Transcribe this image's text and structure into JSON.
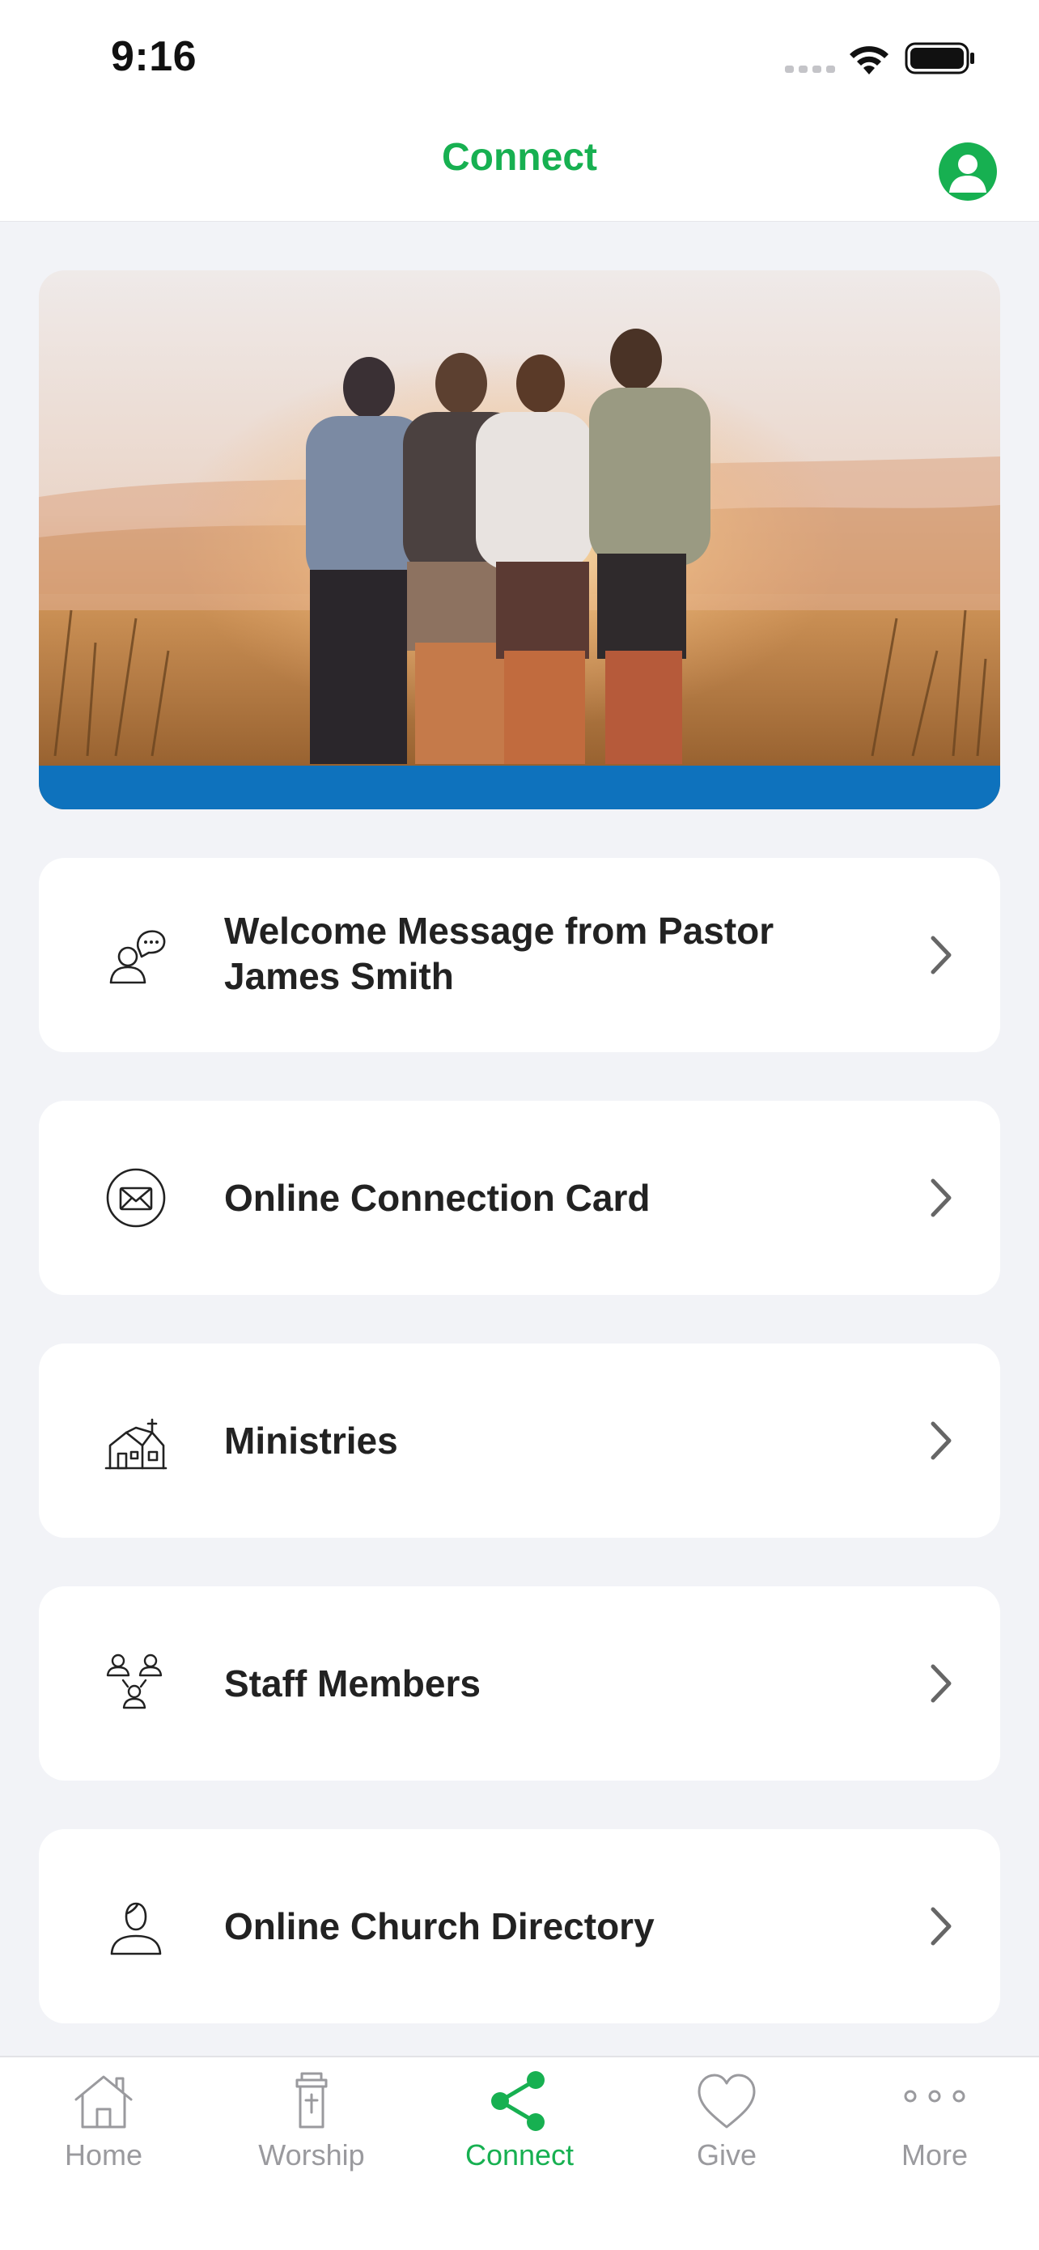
{
  "status_bar": {
    "time": "9:16"
  },
  "header": {
    "title": "Connect",
    "profile_icon": "person-circle-icon"
  },
  "colors": {
    "accent": "#17b051",
    "tab_inactive": "#9a9a9e",
    "background": "#f2f3f7",
    "hero_band": "#0e72bd"
  },
  "hero": {
    "image": "four-friends-at-sunset-photo"
  },
  "items": [
    {
      "label_line1": "Welcome Message from Pastor",
      "label_line2": "James Smith",
      "icon": "speech-bubble-person-icon"
    },
    {
      "label": "Online Connection Card",
      "icon": "envelope-circle-icon"
    },
    {
      "label": "Ministries",
      "icon": "church-building-icon"
    },
    {
      "label": "Staff Members",
      "icon": "people-group-icon"
    },
    {
      "label": "Online Church Directory",
      "icon": "person-outline-icon"
    }
  ],
  "tabs": [
    {
      "label": "Home",
      "icon": "house-icon",
      "active": false
    },
    {
      "label": "Worship",
      "icon": "pulpit-icon",
      "active": false
    },
    {
      "label": "Connect",
      "icon": "share-nodes-icon",
      "active": true
    },
    {
      "label": "Give",
      "icon": "heart-icon",
      "active": false
    },
    {
      "label": "More",
      "icon": "more-dots-icon",
      "active": false
    }
  ]
}
